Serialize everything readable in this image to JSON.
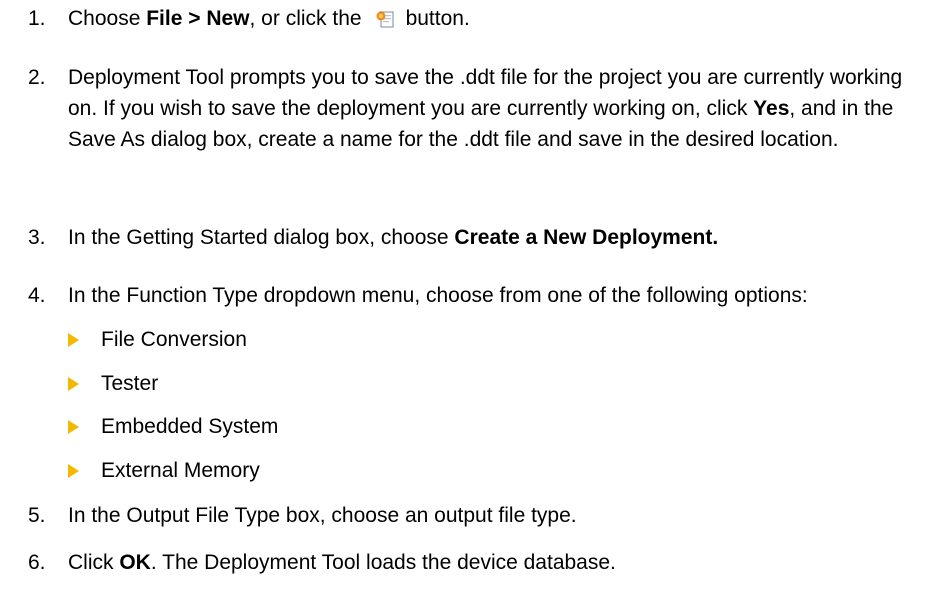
{
  "steps": [
    {
      "number": "1.",
      "text_1": "Choose ",
      "bold_1": "File > New",
      "text_2": ", or click the",
      "icon": "new-deployment-icon",
      "text_3": "button."
    },
    {
      "number": "2.",
      "text_1": "Deployment Tool prompts you to save the .ddt file for the project you are currently working on. If you wish to save the deployment you are currently working on, click ",
      "bold_1": "Yes",
      "text_2": ", and in the Save As dialog box, create a name for the .ddt file and save in the desired location."
    },
    {
      "number": "3.",
      "text_1": "In the Getting Started dialog box, choose ",
      "bold_1": "Create a New Deployment."
    },
    {
      "number": "4.",
      "text_1": "In the Function Type dropdown menu, choose from one of the following options:"
    },
    {
      "number": "5.",
      "text_1": "In the Output File Type box, choose an output file type."
    },
    {
      "number": "6.",
      "text_1": "Click ",
      "bold_1": "OK",
      "text_2": ". The Deployment Tool loads the device database."
    }
  ],
  "function_type_options": [
    "File Conversion",
    "Tester",
    "Embedded System",
    "External Memory"
  ],
  "colors": {
    "bullet": "#f5b800",
    "text": "#000000"
  }
}
